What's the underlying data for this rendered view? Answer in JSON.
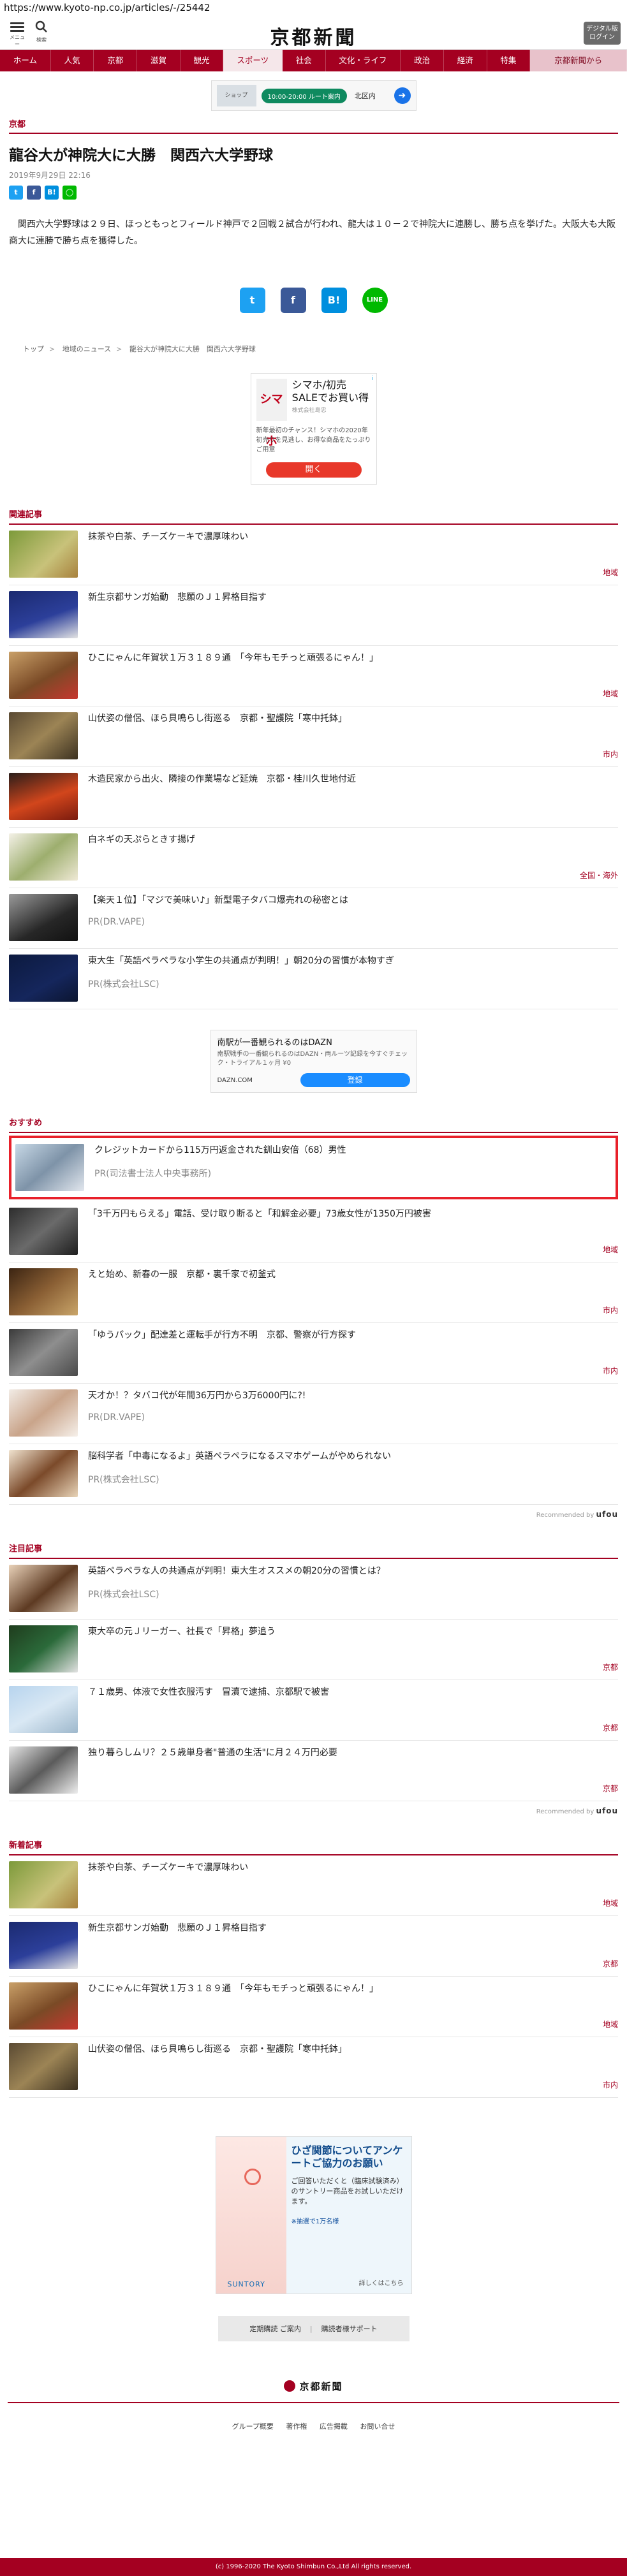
{
  "browser": {
    "url": "https://www.kyoto-np.co.jp/articles/-/25442"
  },
  "header": {
    "menu_caption": "メニュー",
    "search_caption": "検索",
    "logo": "京都新聞",
    "digital_line1": "デジタル版",
    "digital_line2": "ログイン"
  },
  "nav": [
    "ホーム",
    "人気",
    "京都",
    "滋賀",
    "観光",
    "スポーツ",
    "社会",
    "文化・ライフ",
    "政治",
    "経済",
    "特集",
    "京都新聞から"
  ],
  "top_ad": {
    "shop": "ショップ",
    "pill": "10:00-20:00 ルート案内",
    "dest": "北区内",
    "nav_icon": "➜"
  },
  "article": {
    "category": "京都",
    "title": "龍谷大が神院大に大勝　関西六大学野球",
    "date": "2019年9月29日 22:16",
    "body": "関西六大学野球は２９日、ほっともっとフィールド神戸で２回戦２試合が行われ、龍大は１０－２で神院大に連勝し、勝ち点を挙げた。大阪大も大阪商大に連勝で勝ち点を獲得した。",
    "share": {
      "twitter": "t",
      "facebook": "f",
      "hatena": "B!",
      "line": "LINE"
    }
  },
  "breadcrumb": [
    "トップ",
    "地域のニュース",
    "龍谷大が神院大に大勝　関西六大学野球"
  ],
  "ad_box": {
    "mark": "i",
    "logo": "シマホ",
    "head": "シマホ/初売SALEでお買い得",
    "sub": "株式会社島忠",
    "text": "新年最初のチャンス！シマホの2020年初売りを見逃し、お得な商品をたっぷりご用意",
    "cta": "開く"
  },
  "related": {
    "heading": "関連記事",
    "items": [
      {
        "title": "抹茶や白茶、チーズケーキで濃厚味わい",
        "tag": "地域",
        "thumb": "th-matcha",
        "pr": ""
      },
      {
        "title": "新生京都サンガ始動　悲願のＪ１昇格目指す",
        "tag": "",
        "thumb": "th-sanga",
        "pr": ""
      },
      {
        "title": "ひこにゃんに年賀状１万３１８９通　「今年もモチっと頑張るにゃん！」",
        "tag": "地域",
        "thumb": "th-cat",
        "pr": ""
      },
      {
        "title": "山伏姿の僧侶、ほら貝鳴らし街巡る　京都・聖護院「寒中托鉢」",
        "tag": "市内",
        "thumb": "th-eizo",
        "pr": ""
      },
      {
        "title": "木造民家から出火、隣接の作業場など延焼　京都・桂川久世地付近",
        "tag": "",
        "thumb": "th-fire",
        "pr": ""
      },
      {
        "title": "白ネギの天ぷらときす揚げ",
        "tag": "全国・海外",
        "thumb": "th-negi",
        "pr": ""
      },
      {
        "title": "【楽天１位】「マジで美味い♪」新型電子タバコ爆売れの秘密とは",
        "tag": "",
        "thumb": "th-vape",
        "pr": "PR(DR.VAPE)"
      },
      {
        "title": "東大生「英語ペラペラな小学生の共通点が判明！」朝20分の習慣が本物すぎ",
        "tag": "",
        "thumb": "th-kids",
        "pr": "PR(株式会社LSC)"
      }
    ]
  },
  "mid_ad": {
    "t1": "南駅が一番観られるのはDAZN",
    "t2": "南駅戦手の一番観られるのはDAZN・両ルーツ記録を今すぐチェック・トライアル１ヶ月 ¥0",
    "domain": "DAZN.COM",
    "cta": "登録"
  },
  "recommend": {
    "heading": "おすすめ",
    "items": [
      {
        "title": "クレジットカードから115万円返金された釧山安倍（68）男性",
        "tag": "",
        "thumb": "th-card",
        "pr": "PR(司法書士法人中央事務所)",
        "highlight": true
      },
      {
        "title": "「3千万円もらえる」電話、受け取り断ると「和解金必要」73歳女性が1350万円被害",
        "tag": "地域",
        "thumb": "th-phone",
        "pr": "",
        "highlight": false
      },
      {
        "title": "えと始め、新春の一服　京都・裏千家で初釜式",
        "tag": "市内",
        "thumb": "th-tea",
        "pr": "",
        "highlight": false
      },
      {
        "title": "「ゆうパック」配達差と運転手が行方不明　京都、警察が行方探す",
        "tag": "市内",
        "thumb": "th-yupack",
        "pr": "",
        "highlight": false
      },
      {
        "title": "天才か！？タバコ代が年間36万円から3万6000円に?!",
        "tag": "",
        "thumb": "th-woman",
        "pr": "PR(DR.VAPE)",
        "highlight": false
      },
      {
        "title": "脳科学者「中毒になるよ」英語ペラペラになるスマホゲームがやめられない",
        "tag": "",
        "thumb": "th-game",
        "pr": "PR(株式会社LSC)",
        "highlight": false
      }
    ],
    "rec_by": "Recommended by",
    "rec_brand": "ufou"
  },
  "featured": {
    "heading": "注目記事",
    "items": [
      {
        "title": "英語ペラペラな人の共通点が判明！東大生オススメの朝20分の習慣とは？",
        "tag": "",
        "thumb": "th-speaker",
        "pr": "PR(株式会社LSC)"
      },
      {
        "title": "東大卒の元Ｊリーガー、社長で「昇格」夢追う",
        "tag": "京都",
        "thumb": "th-player",
        "pr": ""
      },
      {
        "title": "７１歳男、体液で女性衣服汚す　冒瀆で逮捕、京都駅で被害",
        "tag": "京都",
        "thumb": "th-police",
        "pr": ""
      },
      {
        "title": "独り暮らしムリ？２５歳単身者\"普通の生活\"に月２４万円必要",
        "tag": "京都",
        "thumb": "th-old",
        "pr": ""
      }
    ],
    "rec_by": "Recommended by",
    "rec_brand": "ufou"
  },
  "latest": {
    "heading": "新着記事",
    "items": [
      {
        "title": "抹茶や白茶、チーズケーキで濃厚味わい",
        "tag": "地域",
        "thumb": "th-matcha"
      },
      {
        "title": "新生京都サンガ始動　悲願のＪ１昇格目指す",
        "tag": "京都",
        "thumb": "th-sanga"
      },
      {
        "title": "ひこにゃんに年賀状１万３１８９通　「今年もモチっと頑張るにゃん！」",
        "tag": "地域",
        "thumb": "th-cat"
      },
      {
        "title": "山伏姿の僧侶、ほら貝鳴らし街巡る　京都・聖護院「寒中托鉢」",
        "tag": "市内",
        "thumb": "th-eizo"
      }
    ]
  },
  "bottom_ad": {
    "head": "ひざ関節についてアンケートご協力のお願い",
    "body": "ご回答いただくと（臨床試験済み）のサントリー商品をお試しいただけます。",
    "foot": "※抽選で1万名様",
    "brand": "SUNTORY",
    "cta": "詳しくはこちら"
  },
  "service": {
    "subscribe": "定期購読 ご案内",
    "support": "購読者様サポート"
  },
  "footer": {
    "logo": "京都新聞",
    "links": [
      "グループ概要",
      "著作権",
      "広告掲載",
      "お問い合せ"
    ],
    "copyright": "(c) 1996-2020 The Kyoto Shimbun Co.,Ltd All rights reserved."
  },
  "colors": {
    "brand": "#a40021",
    "highlight": "#e8202a"
  }
}
